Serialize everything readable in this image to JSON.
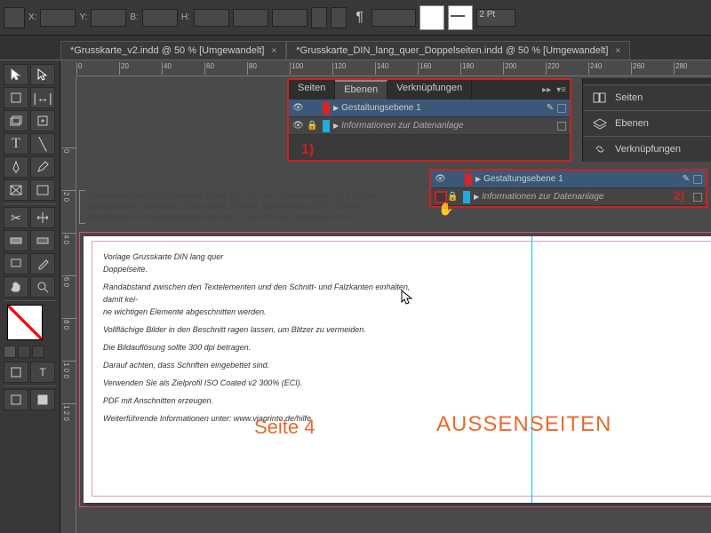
{
  "top": {
    "xy_label": "X:",
    "y_label": "Y:",
    "w_label": "B:",
    "h_label": "H:",
    "stroke_label": "2 Pt"
  },
  "tabs": [
    {
      "label": "*Grusskarte_v2.indd @ 50 % [Umgewandelt]"
    },
    {
      "label": "*Grusskarte_DIN_lang_quer_Doppelseiten.indd @ 50 % [Umgewandelt]"
    }
  ],
  "hruler": [
    "0",
    "20",
    "40",
    "60",
    "80",
    "100",
    "120",
    "140",
    "160",
    "180",
    "200",
    "220",
    "240",
    "260",
    "280"
  ],
  "vruler": [
    "0",
    "2 0",
    "4 0",
    "6 0",
    "8 0",
    "1 0 0",
    "1 2 0"
  ],
  "panel1": {
    "tabs": [
      "Seiten",
      "Ebenen",
      "Verknüpfungen"
    ],
    "layers": [
      {
        "name": "Gestaltungsebene 1"
      },
      {
        "name": "Informationen zur Datenanlage"
      }
    ],
    "annotation": "1)"
  },
  "panel2": {
    "layers": [
      {
        "name": "Gestaltungsebene 1"
      },
      {
        "name": "Informationen zur Datenanlage"
      }
    ],
    "annotation": "2)"
  },
  "dock": {
    "pages": "Seiten",
    "layers": "Ebenen",
    "links": "Verknüpfungen"
  },
  "callouts": [
    "Dokumentengröße mit Beschnitt:   Offen 426 x 111  mm; Geschlossen 216 x 111 mm",
    "Seitengröße im Endformat:  Offen 420 x 105  mm; Geschlossen  210 x 105 mm",
    "Randabstand von Gestaltungselementen zu Schnitt- und Falzkanten 4 mm"
  ],
  "doc": {
    "title1": "Vorlage Grusskarte DIN lang quer",
    "title2": "Doppelseite.",
    "p1": "Randabstand zwischen den Textelementen und den Schnitt- und Falzkanten einhalten, damit kei-",
    "p1b": "ne wichtigen Elemente abgeschnitten werden.",
    "p2": "Vollflächige Bilder in den Beschnitt ragen lassen, um Blitzer zu vermeiden.",
    "p3": "Die Bildauflösung sollte 300 dpi betragen.",
    "p4": "Darauf achten, dass Schriften eingebettet sind.",
    "p5": "Verwenden Sie als Zielprofil ISO Coated v2 300% (ECI).",
    "p6": "PDF mit Anschnitten erzeugen.",
    "p7": "Weiterführende Informationen unter: www.viaprinto.de/hilfe",
    "page4": "Seite 4",
    "outer": "AUSSENSEITEN"
  }
}
